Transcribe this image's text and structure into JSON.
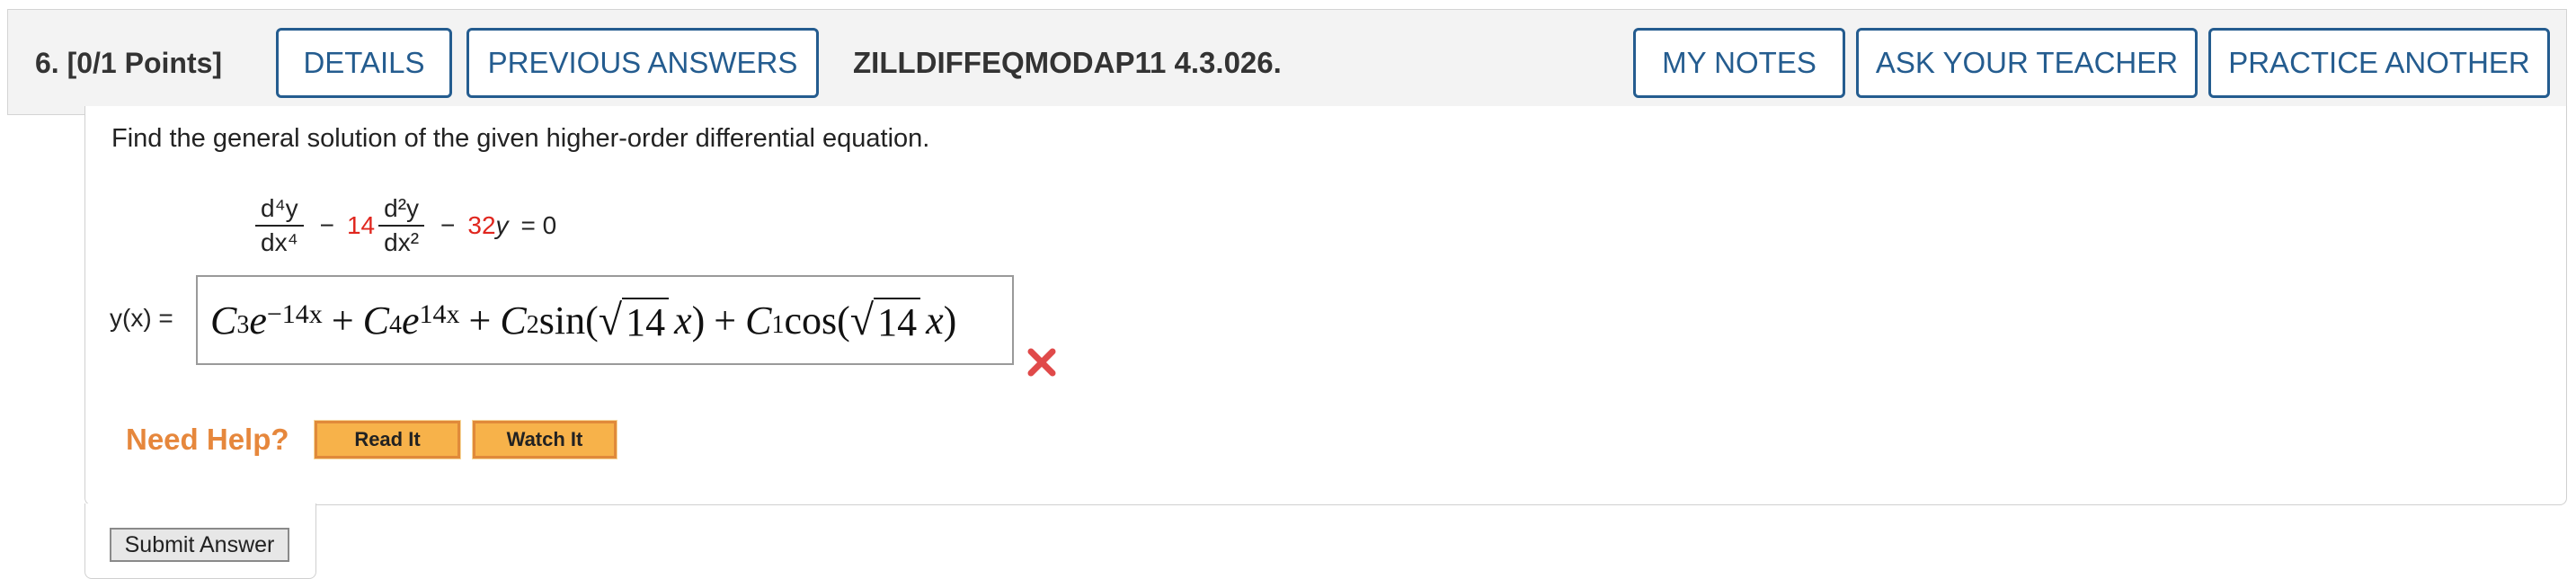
{
  "header": {
    "question_label": "6.  [0/1 Points]",
    "details_label": "DETAILS",
    "previous_answers_label": "PREVIOUS ANSWERS",
    "question_code": "ZILLDIFFEQMODAP11 4.3.026.",
    "my_notes_label": "MY NOTES",
    "ask_teacher_label": "ASK YOUR TEACHER",
    "practice_another_label": "PRACTICE ANOTHER"
  },
  "question": {
    "instruction": "Find the general solution of the given higher-order differential equation.",
    "equation": {
      "term1_num": "d⁴y",
      "term1_den": "dx⁴",
      "minus1": "−",
      "coef1": "14",
      "term2_num": "d²y",
      "term2_den": "dx²",
      "minus2": "−",
      "coef2": "32",
      "y": "y",
      "equals_zero": "= 0"
    }
  },
  "answer": {
    "label": "y(x) =",
    "c3": "C",
    "c3_sub": "3",
    "e1": "e",
    "exp1": "−14x",
    "plus1": "+",
    "c4": "C",
    "c4_sub": "4",
    "e2": "e",
    "exp2": "14x",
    "plus2": "+",
    "c2": "C",
    "c2_sub": "2",
    "sin": "sin",
    "lp1": "(",
    "sqrt1": "14",
    "x1": "x",
    "rp1": ")",
    "plus3": "+",
    "c1": "C",
    "c1_sub": "1",
    "cos": "cos",
    "lp2": "(",
    "sqrt2": "14",
    "x2": "x",
    "rp2": ")",
    "status": "incorrect",
    "status_icon": "x-mark-icon",
    "status_color": "#e04a4a"
  },
  "help": {
    "title": "Need Help?",
    "read_it_label": "Read It",
    "watch_it_label": "Watch It",
    "title_color": "#e6873c",
    "button_color": "#f7b24a"
  },
  "submit_label": "Submit Answer",
  "colors": {
    "accent": "#245c8f",
    "coefficient_red": "#e0261e"
  }
}
